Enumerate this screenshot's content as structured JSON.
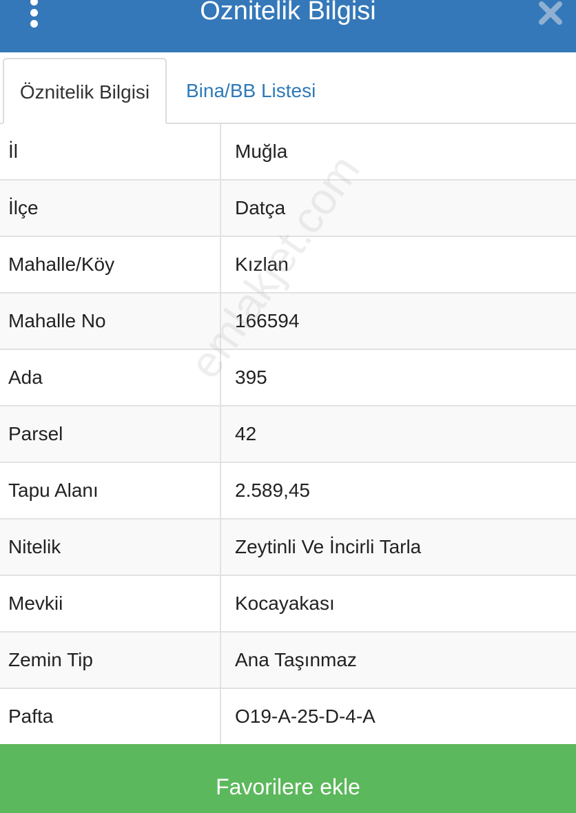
{
  "header": {
    "title": "Öznitelik Bilgisi",
    "menu_icon": "vertical-dots-icon",
    "close_icon": "close-icon",
    "background": "#3478b9"
  },
  "tabs": [
    {
      "label": "Öznitelik Bilgisi",
      "active": true
    },
    {
      "label": "Bina/BB Listesi",
      "active": false
    }
  ],
  "rows": [
    {
      "label": "İl",
      "value": "Muğla"
    },
    {
      "label": "İlçe",
      "value": "Datça"
    },
    {
      "label": "Mahalle/Köy",
      "value": "Kızlan"
    },
    {
      "label": "Mahalle No",
      "value": "166594"
    },
    {
      "label": "Ada",
      "value": "395"
    },
    {
      "label": "Parsel",
      "value": "42"
    },
    {
      "label": "Tapu Alanı",
      "value": "2.589,45"
    },
    {
      "label": "Nitelik",
      "value": "Zeytinli Ve İncirli Tarla"
    },
    {
      "label": "Mevkii",
      "value": "Kocayakası"
    },
    {
      "label": "Zemin Tip",
      "value": "Ana Taşınmaz"
    },
    {
      "label": "Pafta",
      "value": "O19-A-25-D-4-A"
    }
  ],
  "footer": {
    "favorite_label": "Favorilere ekle",
    "button_color": "#5cb85c"
  },
  "watermark": {
    "text": "emlakjet.com"
  }
}
